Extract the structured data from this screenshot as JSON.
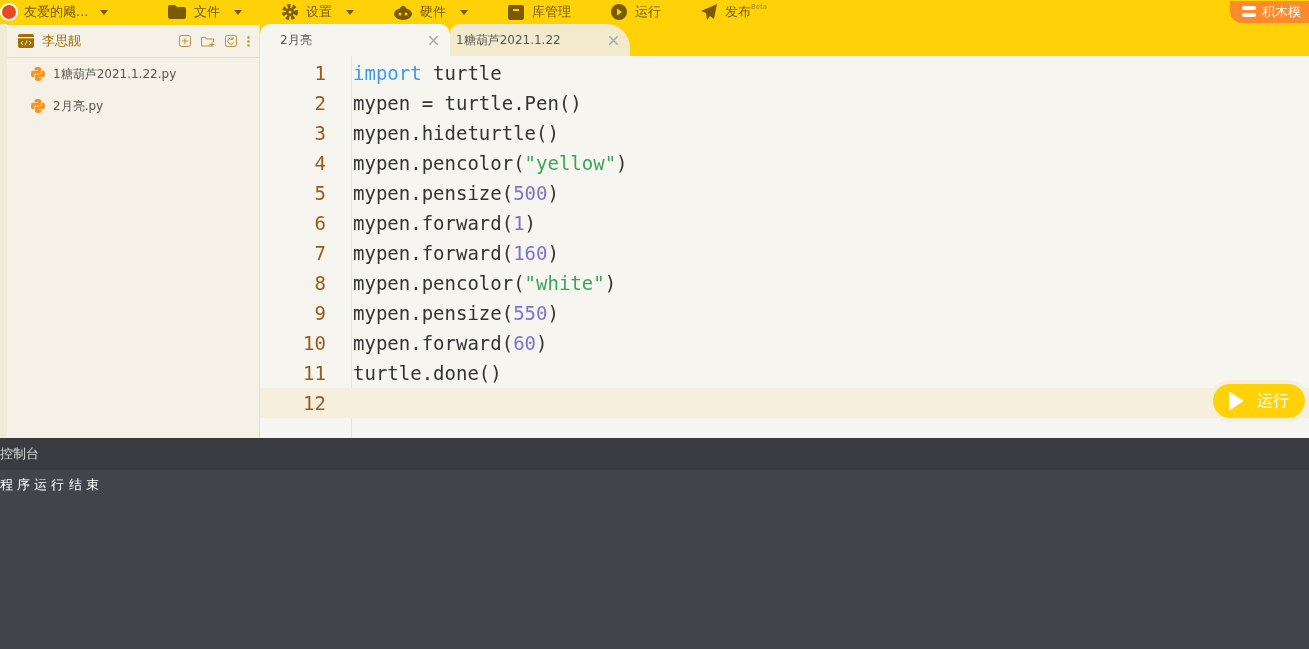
{
  "menu_bar": {
    "user": "友爱的飓...",
    "items": [
      {
        "label": "文件",
        "dropdown": true
      },
      {
        "label": "设置",
        "dropdown": true
      },
      {
        "label": "硬件",
        "dropdown": true
      },
      {
        "label": "库管理",
        "dropdown": false
      },
      {
        "label": "运行",
        "dropdown": false
      },
      {
        "label": "发布",
        "dropdown": false,
        "badge": "Beta"
      }
    ],
    "mode_button": "积木模"
  },
  "sidebar": {
    "title": "李思靓",
    "files": [
      {
        "name": "1糖葫芦2021.1.22.py"
      },
      {
        "name": "2月亮.py"
      }
    ]
  },
  "tabs": [
    {
      "label": "2月亮",
      "selected": true
    },
    {
      "label": "1糖葫芦2021.1.22",
      "selected": false
    }
  ],
  "editor": {
    "lines": [
      {
        "number": "1",
        "current": false,
        "tokens": [
          {
            "kind": "keyword",
            "text": "import"
          },
          {
            "kind": "plain",
            "text": " turtle"
          }
        ]
      },
      {
        "number": "2",
        "current": false,
        "tokens": [
          {
            "kind": "plain",
            "text": "mypen = turtle.Pen()"
          }
        ]
      },
      {
        "number": "3",
        "current": false,
        "tokens": [
          {
            "kind": "plain",
            "text": "mypen.hideturtle()"
          }
        ]
      },
      {
        "number": "4",
        "current": false,
        "tokens": [
          {
            "kind": "plain",
            "text": "mypen.pencolor("
          },
          {
            "kind": "string",
            "text": "\"yellow\""
          },
          {
            "kind": "plain",
            "text": ")"
          }
        ]
      },
      {
        "number": "5",
        "current": false,
        "tokens": [
          {
            "kind": "plain",
            "text": "mypen.pensize("
          },
          {
            "kind": "number",
            "text": "500"
          },
          {
            "kind": "plain",
            "text": ")"
          }
        ]
      },
      {
        "number": "6",
        "current": false,
        "tokens": [
          {
            "kind": "plain",
            "text": "mypen.forward("
          },
          {
            "kind": "number",
            "text": "1"
          },
          {
            "kind": "plain",
            "text": ")"
          }
        ]
      },
      {
        "number": "7",
        "current": false,
        "tokens": [
          {
            "kind": "plain",
            "text": "mypen.forward("
          },
          {
            "kind": "number",
            "text": "160"
          },
          {
            "kind": "plain",
            "text": ")"
          }
        ]
      },
      {
        "number": "8",
        "current": false,
        "tokens": [
          {
            "kind": "plain",
            "text": "mypen.pencolor("
          },
          {
            "kind": "string",
            "text": "\"white\""
          },
          {
            "kind": "plain",
            "text": ")"
          }
        ]
      },
      {
        "number": "9",
        "current": false,
        "tokens": [
          {
            "kind": "plain",
            "text": "mypen.pensize("
          },
          {
            "kind": "number",
            "text": "550"
          },
          {
            "kind": "plain",
            "text": ")"
          }
        ]
      },
      {
        "number": "10",
        "current": false,
        "tokens": [
          {
            "kind": "plain",
            "text": "mypen.forward("
          },
          {
            "kind": "number",
            "text": "60"
          },
          {
            "kind": "plain",
            "text": ")"
          }
        ]
      },
      {
        "number": "11",
        "current": false,
        "tokens": [
          {
            "kind": "plain",
            "text": "turtle.done()"
          }
        ]
      },
      {
        "number": "12",
        "current": true
      }
    ],
    "run_button": "运行"
  },
  "console": {
    "title": "控制台",
    "output": "程 序 运 行 结 束"
  }
}
